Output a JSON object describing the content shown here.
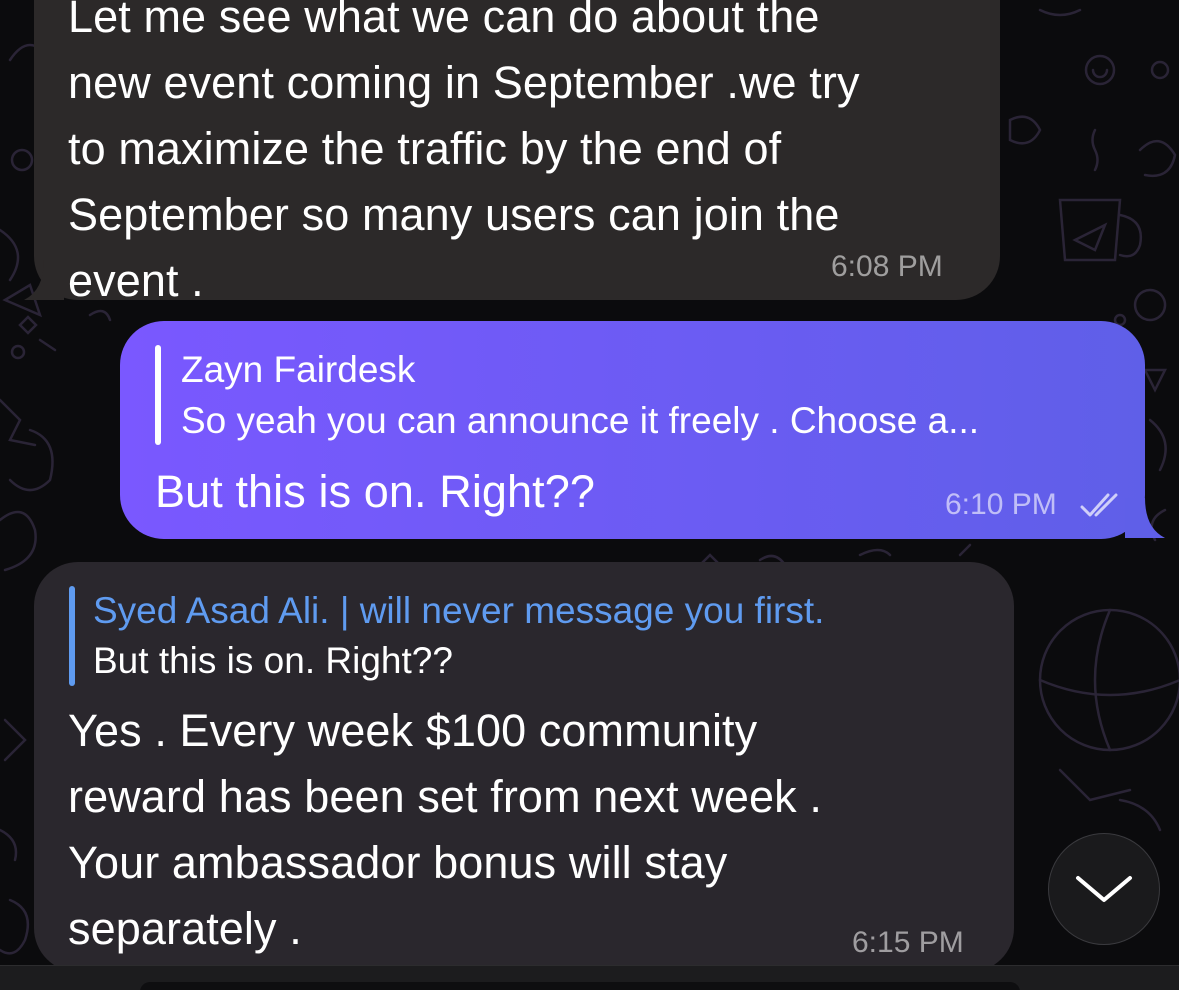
{
  "colors": {
    "incoming_bubble": "#2c2929",
    "outgoing_bubble": "#6a5cf2",
    "reply_name_blue": "#5f9bf0",
    "background": "#0b0b0d"
  },
  "messages": [
    {
      "direction": "incoming",
      "text": "Let me see what we can do about the\nnew event coming in September .we try\nto maximize the traffic by the end of\nSeptember so many users can join the\nevent .",
      "time": "6:08 PM"
    },
    {
      "direction": "outgoing",
      "reply_to": {
        "name": "Zayn Fairdesk",
        "text": "So yeah you can announce it freely . Choose a..."
      },
      "text": "But this is on. Right??",
      "time": "6:10 PM",
      "status_icon": "double-check-icon"
    },
    {
      "direction": "incoming",
      "reply_to": {
        "name": "Syed Asad Ali. | will never message you first.",
        "text": "But this is on. Right??"
      },
      "text": "Yes . Every week $100 community\nreward has been set from next week .\nYour ambassador bonus will stay\nseparately .",
      "time": "6:15 PM"
    }
  ],
  "scroll_button": {
    "icon": "chevron-down-icon"
  }
}
